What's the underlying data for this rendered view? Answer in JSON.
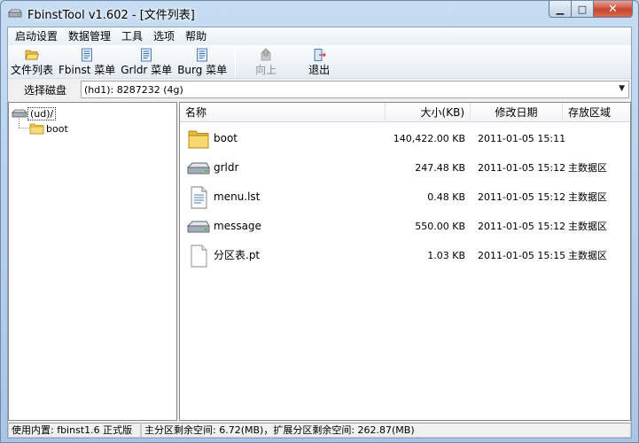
{
  "window": {
    "title": "FbinstTool v1.602 - [文件列表]"
  },
  "menu": [
    "启动设置",
    "数据管理",
    "工具",
    "选项",
    "帮助"
  ],
  "toolbar": {
    "file_list": "文件列表",
    "fbinst_menu": "Fbinst 菜单",
    "grldr_menu": "Grldr 菜单",
    "burg_menu": "Burg 菜单",
    "up": "向上",
    "exit": "退出"
  },
  "disk": {
    "label": "选择磁盘",
    "selected": "(hd1): 8287232 (4g)"
  },
  "tree": {
    "root": "(ud)/",
    "child": "boot"
  },
  "list": {
    "columns": {
      "name": "名称",
      "size": "大小(KB)",
      "date": "修改日期",
      "area": "存放区域"
    },
    "rows": [
      {
        "name": "boot",
        "size": "140,422.00 KB",
        "date": "2011-01-05 15:11",
        "area": "",
        "icon": "folder-icon"
      },
      {
        "name": "grldr",
        "size": "247.48 KB",
        "date": "2011-01-05 15:12",
        "area": "主数据区",
        "icon": "drive-icon"
      },
      {
        "name": "menu.lst",
        "size": "0.48 KB",
        "date": "2011-01-05 15:12",
        "area": "主数据区",
        "icon": "text-file-icon"
      },
      {
        "name": "message",
        "size": "550.00 KB",
        "date": "2011-01-05 15:12",
        "area": "主数据区",
        "icon": "drive-icon"
      },
      {
        "name": "分区表.pt",
        "size": "1.03 KB",
        "date": "2011-01-05 15:15",
        "area": "主数据区",
        "icon": "blank-file-icon"
      }
    ]
  },
  "status": {
    "kernel": "使用内置: fbinst1.6 正式版",
    "space": "主分区剩余空间: 6.72(MB)，扩展分区剩余空间: 262.87(MB)"
  },
  "colors": {
    "folder": "#f3c84a",
    "accent": "#3d6ea8"
  }
}
